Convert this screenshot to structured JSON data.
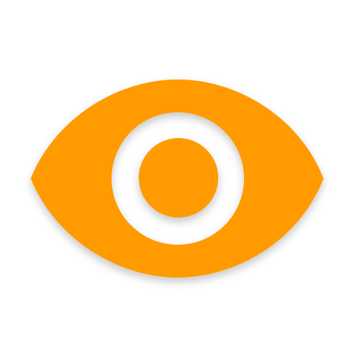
{
  "icon": {
    "name": "eye-icon",
    "color": "#FF9A05",
    "background": "#FFFFFF",
    "shadow_color": "#000000"
  }
}
